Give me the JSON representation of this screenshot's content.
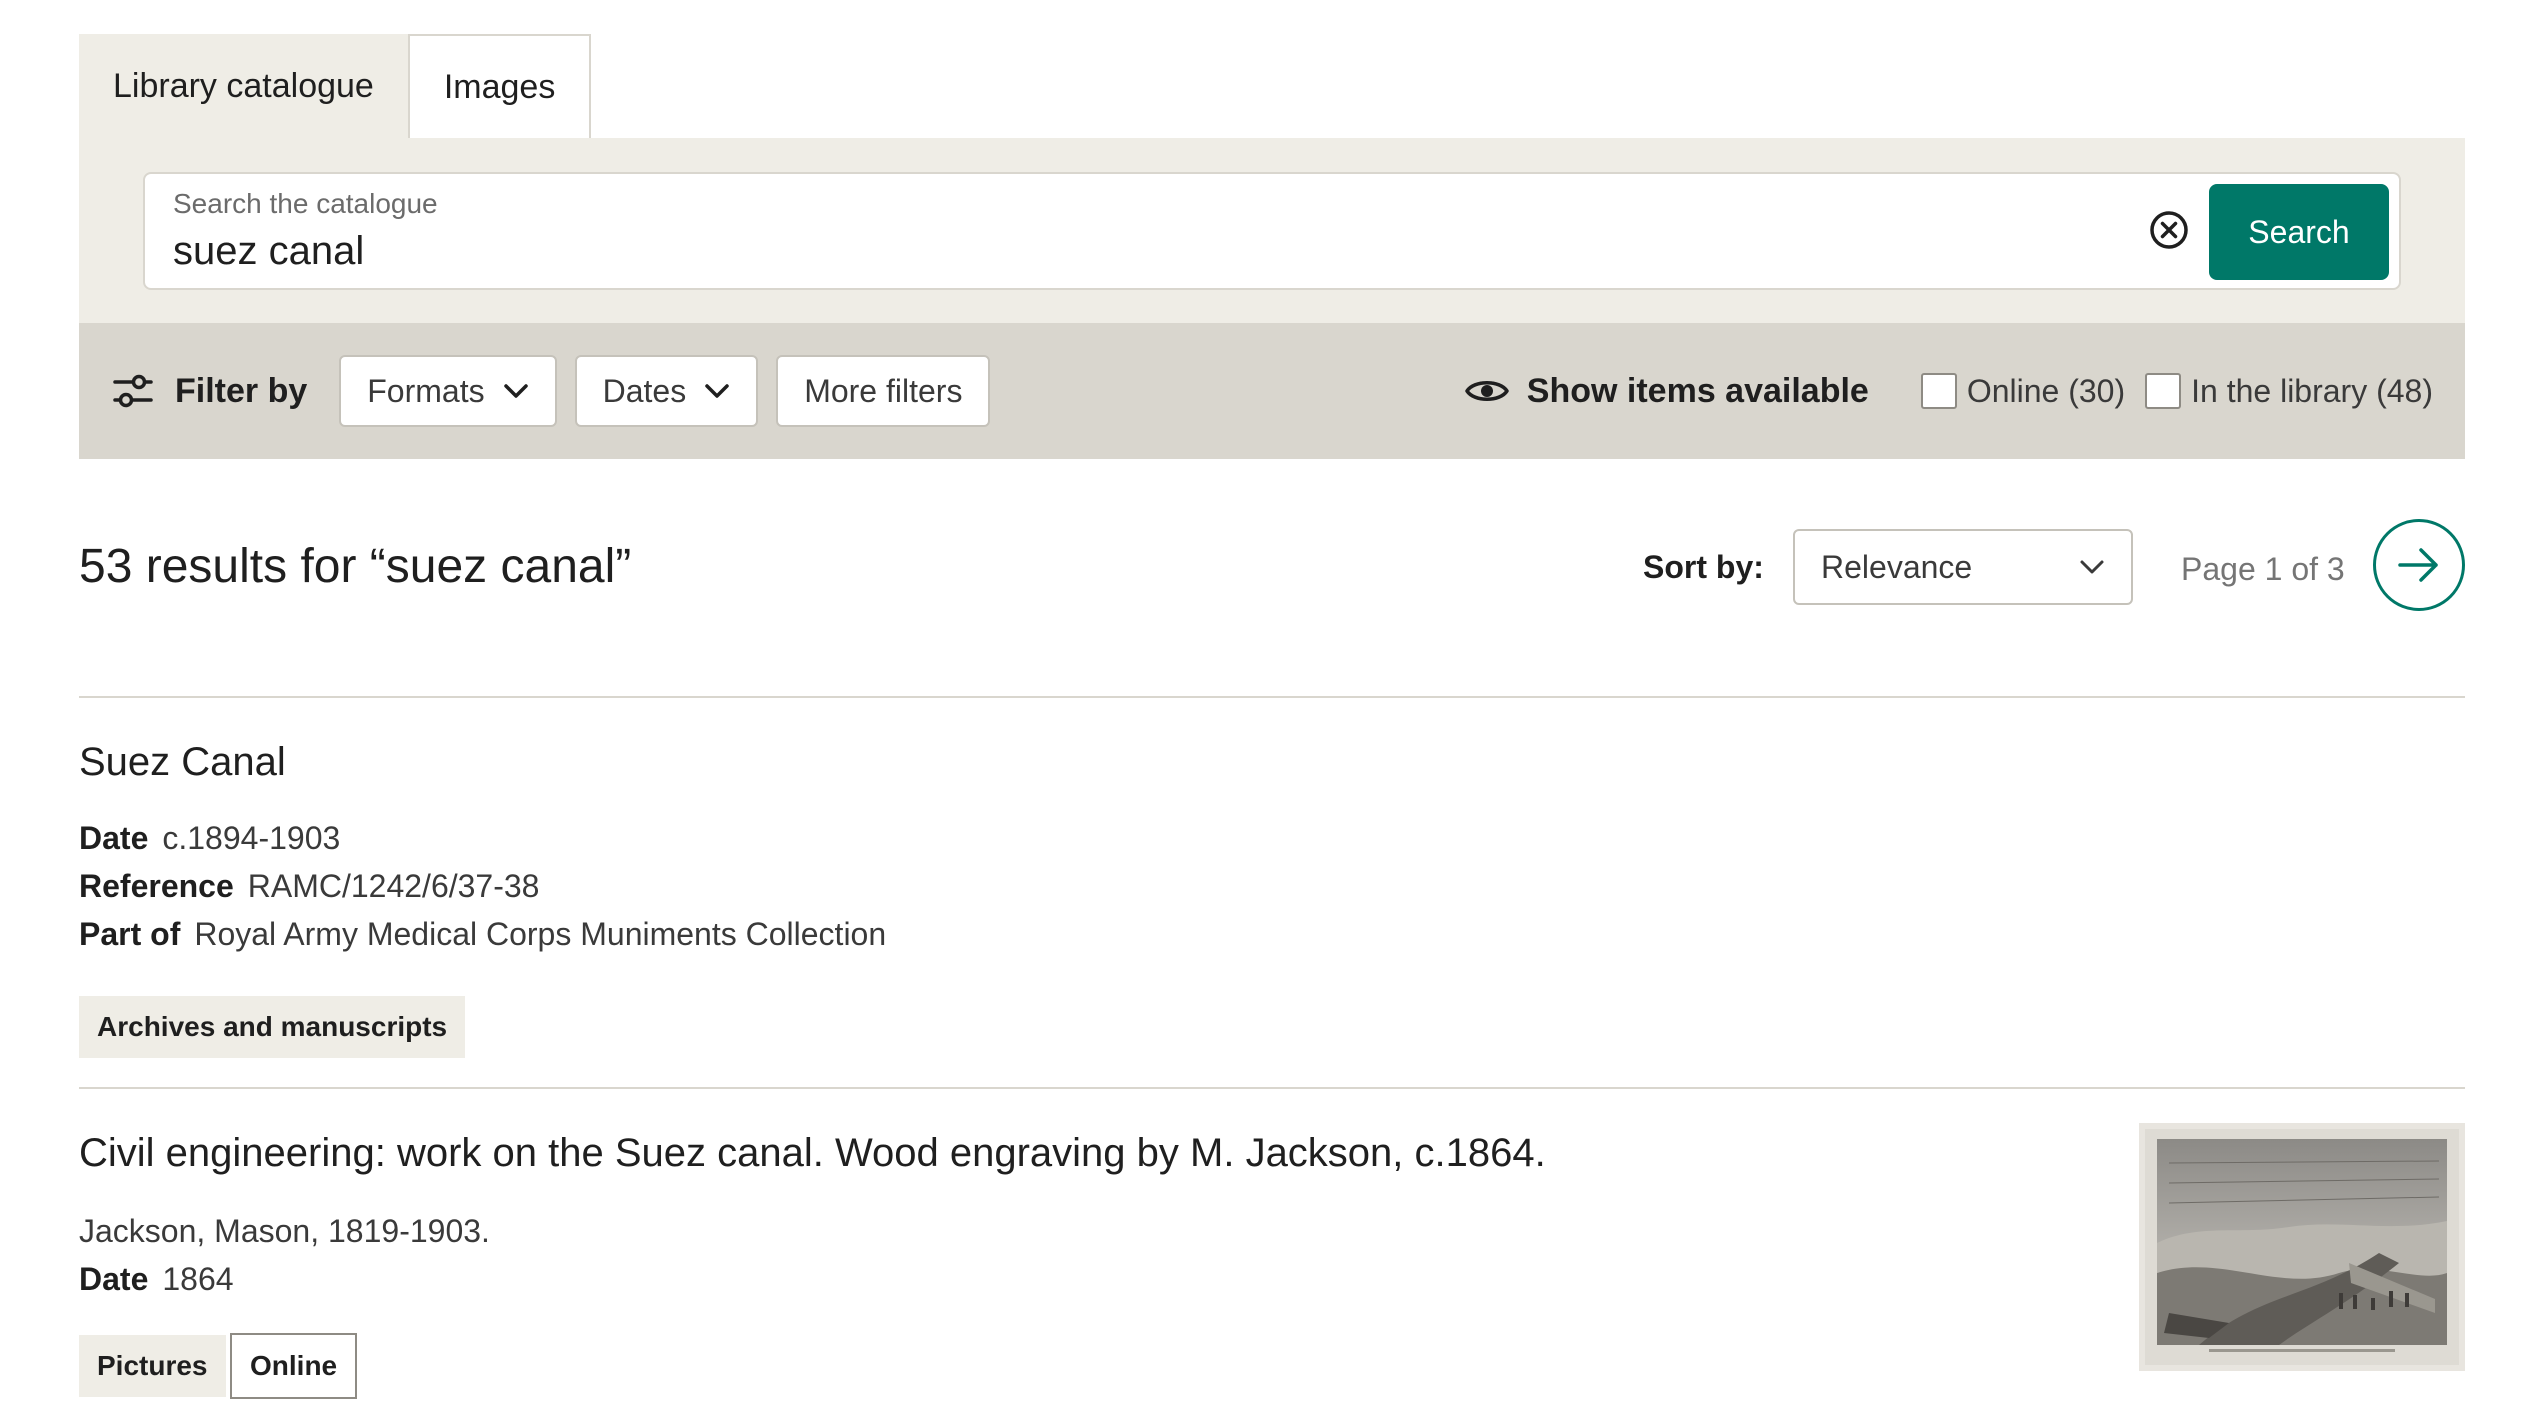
{
  "tabs": [
    {
      "label": "Library catalogue",
      "active": true
    },
    {
      "label": "Images",
      "active": false
    }
  ],
  "search": {
    "label": "Search the catalogue",
    "value": "suez canal",
    "button_label": "Search",
    "clear_icon": "clear-circle-x-icon"
  },
  "filters": {
    "label": "Filter by",
    "icon": "sliders-icon",
    "dropdowns": [
      "Formats",
      "Dates",
      "More filters"
    ],
    "availability_label": "Show items available",
    "availability_icon": "eye-icon",
    "checkboxes": [
      {
        "label": "Online (30)",
        "checked": false
      },
      {
        "label": "In the library (48)",
        "checked": false
      }
    ]
  },
  "results": {
    "heading": "53 results for “suez canal”",
    "sort_label": "Sort by:",
    "sort_value": "Relevance",
    "page_text": "Page 1 of 3",
    "next_icon": "arrow-right-icon"
  },
  "items": [
    {
      "title": "Suez Canal",
      "meta": [
        {
          "label": "Date",
          "value": "c.1894-1903"
        },
        {
          "label": "Reference",
          "value": "RAMC/1242/6/37-38"
        },
        {
          "label": "Part of",
          "value": "Royal Army Medical Corps Muniments Collection"
        }
      ],
      "tags": [
        "Archives and manuscripts"
      ]
    },
    {
      "title": "Civil engineering: work on the Suez canal. Wood engraving by M. Jackson, c.1864.",
      "contributor": "Jackson, Mason, 1819-1903.",
      "meta": [
        {
          "label": "Date",
          "value": "1864"
        }
      ],
      "tags": [
        "Pictures",
        "Online"
      ],
      "thumbnail": "engraving-thumbnail"
    }
  ],
  "colors": {
    "accent": "#007868",
    "panel": "#efede6",
    "filter_bar": "#d9d6ce",
    "text": "#1f1f1f"
  }
}
